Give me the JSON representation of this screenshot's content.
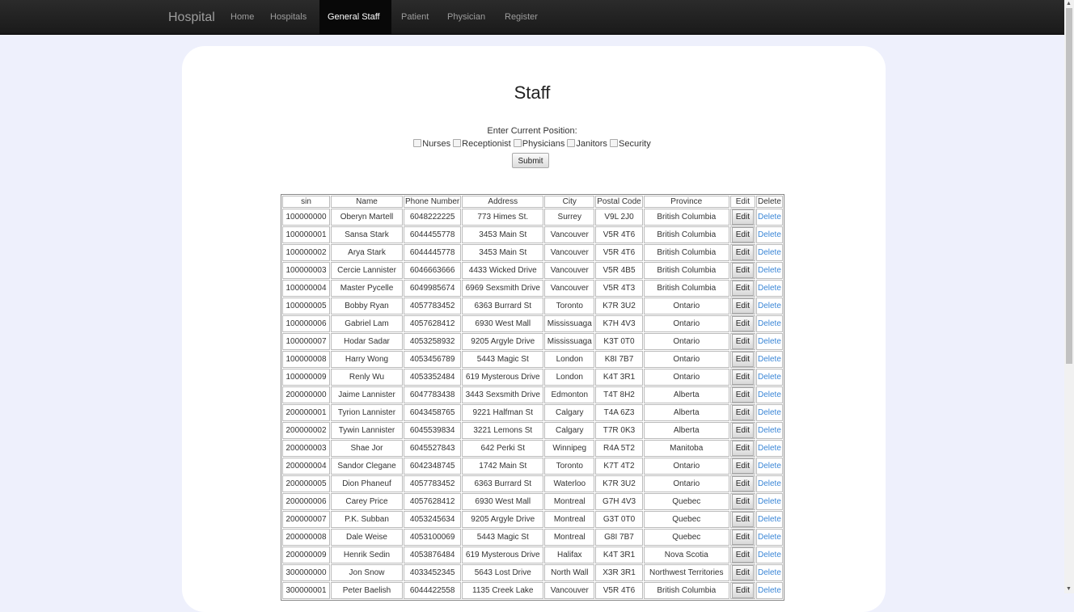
{
  "navbar": {
    "brand": "Hospital",
    "items": [
      {
        "label": "Home",
        "active": false
      },
      {
        "label": "Hospitals",
        "active": false
      },
      {
        "label": "General Staff",
        "active": true
      },
      {
        "label": "Patient",
        "active": false
      },
      {
        "label": "Physician",
        "active": false
      },
      {
        "label": "Register",
        "active": false
      }
    ]
  },
  "page": {
    "title": "Staff",
    "form_label": "Enter Current Position:",
    "positions": [
      "Nurses",
      "Receptionist",
      "Physicians",
      "Janitors",
      "Security"
    ],
    "submit_label": "Submit"
  },
  "table": {
    "columns": [
      "sin",
      "Name",
      "Phone Number",
      "Address",
      "City",
      "Postal Code",
      "Province",
      "Edit",
      "Delete"
    ],
    "edit_label": "Edit",
    "delete_label": "Delete",
    "rows": [
      [
        "100000000",
        "Oberyn Martell",
        "6048222225",
        "773 Himes St.",
        "Surrey",
        "V9L 2J0",
        "British Columbia"
      ],
      [
        "100000001",
        "Sansa Stark",
        "6044455778",
        "3453 Main St",
        "Vancouver",
        "V5R 4T6",
        "British Columbia"
      ],
      [
        "100000002",
        "Arya Stark",
        "6044445778",
        "3453 Main St",
        "Vancouver",
        "V5R 4T6",
        "British Columbia"
      ],
      [
        "100000003",
        "Cercie Lannister",
        "6046663666",
        "4433 Wicked Drive",
        "Vancouver",
        "V5R 4B5",
        "British Columbia"
      ],
      [
        "100000004",
        "Master Pycelle",
        "6049985674",
        "6969 Sexsmith Drive",
        "Vancouver",
        "V5R 4T3",
        "British Columbia"
      ],
      [
        "100000005",
        "Bobby Ryan",
        "4057783452",
        "6363 Burrard St",
        "Toronto",
        "K7R 3U2",
        "Ontario"
      ],
      [
        "100000006",
        "Gabriel Lam",
        "4057628412",
        "6930 West Mall",
        "Mississuaga",
        "K7H 4V3",
        "Ontario"
      ],
      [
        "100000007",
        "Hodar Sadar",
        "4053258932",
        "9205 Argyle Drive",
        "Mississuaga",
        "K3T 0T0",
        "Ontario"
      ],
      [
        "100000008",
        "Harry Wong",
        "4053456789",
        "5443 Magic St",
        "London",
        "K8I 7B7",
        "Ontario"
      ],
      [
        "100000009",
        "Renly Wu",
        "4053352484",
        "619 Mysterous Drive",
        "London",
        "K4T 3R1",
        "Ontario"
      ],
      [
        "200000000",
        "Jaime Lannister",
        "6047783438",
        "3443 Sexsmith Drive",
        "Edmonton",
        "T4T 8H2",
        "Alberta"
      ],
      [
        "200000001",
        "Tyrion Lannister",
        "6043458765",
        "9221 Halfman St",
        "Calgary",
        "T4A 6Z3",
        "Alberta"
      ],
      [
        "200000002",
        "Tywin Lannister",
        "6045539834",
        "3221 Lemons St",
        "Calgary",
        "T7R 0K3",
        "Alberta"
      ],
      [
        "200000003",
        "Shae Jor",
        "6045527843",
        "642 Perki St",
        "Winnipeg",
        "R4A 5T2",
        "Manitoba"
      ],
      [
        "200000004",
        "Sandor Clegane",
        "6042348745",
        "1742 Main St",
        "Toronto",
        "K7T 4T2",
        "Ontario"
      ],
      [
        "200000005",
        "Dion Phaneuf",
        "4057783452",
        "6363 Burrard St",
        "Waterloo",
        "K7R 3U2",
        "Ontario"
      ],
      [
        "200000006",
        "Carey Price",
        "4057628412",
        "6930 West Mall",
        "Montreal",
        "G7H 4V3",
        "Quebec"
      ],
      [
        "200000007",
        "P.K. Subban",
        "4053245634",
        "9205 Argyle Drive",
        "Montreal",
        "G3T 0T0",
        "Quebec"
      ],
      [
        "200000008",
        "Dale Weise",
        "4053100069",
        "5443 Magic St",
        "Montreal",
        "G8I 7B7",
        "Quebec"
      ],
      [
        "200000009",
        "Henrik Sedin",
        "4053876484",
        "619 Mysterous Drive",
        "Halifax",
        "K4T 3R1",
        "Nova Scotia"
      ],
      [
        "300000000",
        "Jon Snow",
        "4033452345",
        "5643 Lost Drive",
        "North Wall",
        "X3R 3R1",
        "Northwest Territories"
      ],
      [
        "300000001",
        "Peter Baelish",
        "6044422558",
        "1135 Creek Lake",
        "Vancouver",
        "V5R 4T6",
        "British Columbia"
      ]
    ]
  },
  "colors": {
    "nav_bg": "#222222",
    "page_bg": "#eef0fc",
    "link": "#3a86d6"
  }
}
